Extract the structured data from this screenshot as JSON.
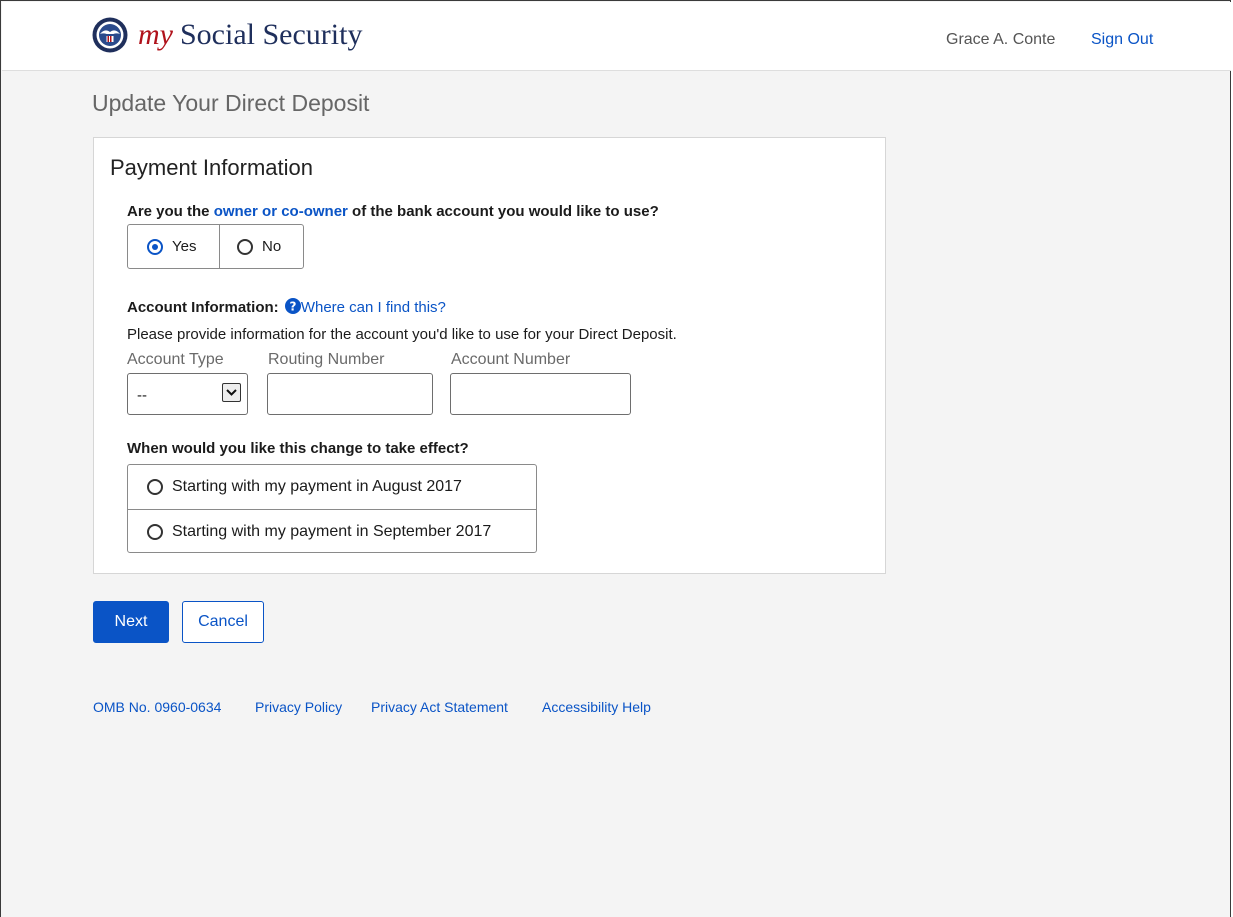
{
  "header": {
    "brand_my": "my",
    "brand_name": "Social Security",
    "user_name": "Grace A. Conte",
    "sign_out": "Sign Out"
  },
  "page": {
    "title": "Update Your Direct Deposit"
  },
  "card": {
    "title": "Payment Information",
    "ownership": {
      "prefix": "Are you the ",
      "link": "owner or co-owner",
      "suffix": " of the bank account you would like to use?",
      "options": [
        {
          "label": "Yes",
          "selected": true
        },
        {
          "label": "No",
          "selected": false
        }
      ]
    },
    "account_info": {
      "label": "Account Information:",
      "help_link": "Where can I find this?",
      "description": "Please provide information for the account you'd like to use for your Direct Deposit.",
      "account_type_label": "Account Type",
      "account_type_value": "--",
      "routing_label": "Routing Number",
      "routing_value": "",
      "account_number_label": "Account Number",
      "account_number_value": ""
    },
    "effective": {
      "question": "When would you like this change to take effect?",
      "options": [
        {
          "label": "Starting with my payment in August 2017",
          "selected": false
        },
        {
          "label": "Starting with my payment in September 2017",
          "selected": false
        }
      ]
    }
  },
  "actions": {
    "next": "Next",
    "cancel": "Cancel"
  },
  "footer": {
    "omb": "OMB No. 0960-0634",
    "privacy_policy": "Privacy Policy",
    "privacy_act": "Privacy Act Statement",
    "accessibility": "Accessibility Help"
  },
  "colors": {
    "link": "#0a54c6",
    "brand_my": "#b0121b",
    "brand_name": "#1f2f5c"
  }
}
